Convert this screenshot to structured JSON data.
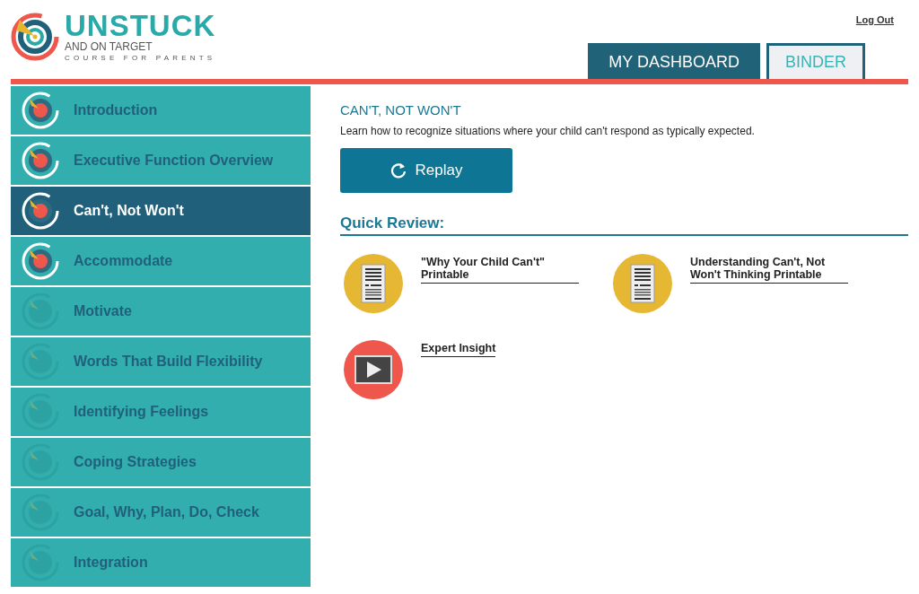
{
  "logo": {
    "title": "UNSTUCK",
    "subtitle": "AND ON TARGET",
    "tagline": "COURSE FOR PARENTS"
  },
  "logout": "Log Out",
  "tabs": [
    {
      "label": "MY DASHBOARD",
      "selected": true
    },
    {
      "label": "BINDER",
      "selected": false
    }
  ],
  "sidebar": {
    "items": [
      {
        "label": "Introduction",
        "selected": false,
        "locked": false
      },
      {
        "label": "Executive Function Overview",
        "selected": false,
        "locked": false
      },
      {
        "label": "Can't, Not Won't",
        "selected": true,
        "locked": false
      },
      {
        "label": "Accommodate",
        "selected": false,
        "locked": false
      },
      {
        "label": "Motivate",
        "selected": false,
        "locked": true
      },
      {
        "label": "Words That Build Flexibility",
        "selected": false,
        "locked": true
      },
      {
        "label": "Identifying Feelings",
        "selected": false,
        "locked": true
      },
      {
        "label": "Coping Strategies",
        "selected": false,
        "locked": true
      },
      {
        "label": "Goal, Why, Plan, Do, Check",
        "selected": false,
        "locked": true
      },
      {
        "label": "Integration",
        "selected": false,
        "locked": true
      }
    ]
  },
  "lesson": {
    "title": "CAN'T, NOT WON'T",
    "description": "Learn how to recognize situations where your child can't respond as typically expected.",
    "replay": "Replay"
  },
  "quick_review": {
    "heading": "Quick Review:",
    "items": [
      {
        "kind": "printable",
        "label": "\"Why Your Child Can't\" Printable"
      },
      {
        "kind": "printable",
        "label": "Understanding Can't, Not Won't Thinking Printable"
      },
      {
        "kind": "video",
        "label": "Expert Insight"
      }
    ]
  }
}
